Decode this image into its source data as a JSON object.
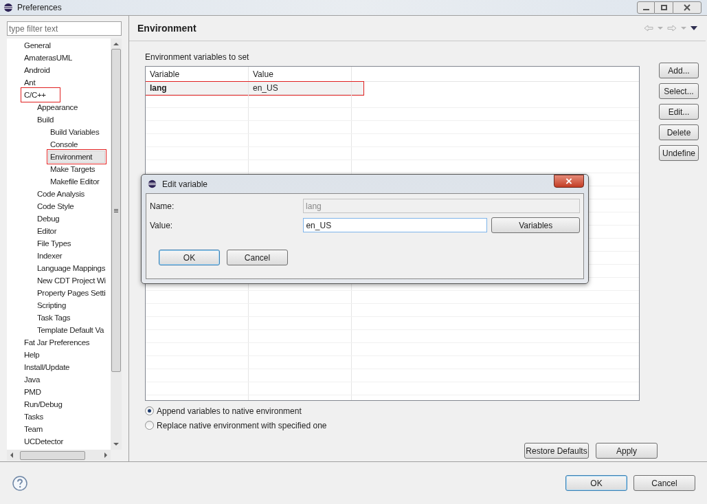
{
  "window": {
    "title": "Preferences"
  },
  "filter": {
    "placeholder": "type filter text"
  },
  "tree": [
    {
      "label": "General",
      "selected": false,
      "highlighted": false
    },
    {
      "label": "AmaterasUML",
      "selected": false,
      "highlighted": false
    },
    {
      "label": "Android",
      "selected": false,
      "highlighted": false
    },
    {
      "label": "Ant",
      "selected": false,
      "highlighted": false
    },
    {
      "label": "C/C++",
      "selected": false,
      "highlighted": true,
      "children": [
        {
          "label": "Appearance",
          "selected": false,
          "highlighted": false
        },
        {
          "label": "Build",
          "selected": false,
          "highlighted": false,
          "children": [
            {
              "label": "Build Variables",
              "selected": false,
              "highlighted": false
            },
            {
              "label": "Console",
              "selected": false,
              "highlighted": false
            },
            {
              "label": "Environment",
              "selected": true,
              "highlighted": true
            },
            {
              "label": "Make Targets",
              "selected": false,
              "highlighted": false
            },
            {
              "label": "Makefile Editor",
              "selected": false,
              "highlighted": false
            }
          ]
        },
        {
          "label": "Code Analysis",
          "selected": false,
          "highlighted": false
        },
        {
          "label": "Code Style",
          "selected": false,
          "highlighted": false
        },
        {
          "label": "Debug",
          "selected": false,
          "highlighted": false
        },
        {
          "label": "Editor",
          "selected": false,
          "highlighted": false
        },
        {
          "label": "File Types",
          "selected": false,
          "highlighted": false
        },
        {
          "label": "Indexer",
          "selected": false,
          "highlighted": false
        },
        {
          "label": "Language Mappings",
          "selected": false,
          "highlighted": false
        },
        {
          "label": "New CDT Project Wi",
          "selected": false,
          "highlighted": false
        },
        {
          "label": "Property Pages Setti",
          "selected": false,
          "highlighted": false
        },
        {
          "label": "Scripting",
          "selected": false,
          "highlighted": false
        },
        {
          "label": "Task Tags",
          "selected": false,
          "highlighted": false
        },
        {
          "label": "Template Default Va",
          "selected": false,
          "highlighted": false
        }
      ]
    },
    {
      "label": "Fat Jar Preferences",
      "selected": false,
      "highlighted": false
    },
    {
      "label": "Help",
      "selected": false,
      "highlighted": false
    },
    {
      "label": "Install/Update",
      "selected": false,
      "highlighted": false
    },
    {
      "label": "Java",
      "selected": false,
      "highlighted": false
    },
    {
      "label": "PMD",
      "selected": false,
      "highlighted": false
    },
    {
      "label": "Run/Debug",
      "selected": false,
      "highlighted": false
    },
    {
      "label": "Tasks",
      "selected": false,
      "highlighted": false
    },
    {
      "label": "Team",
      "selected": false,
      "highlighted": false
    },
    {
      "label": "UCDetector",
      "selected": false,
      "highlighted": false
    }
  ],
  "page": {
    "title": "Environment",
    "table_label": "Environment variables to set",
    "columns": [
      "Variable",
      "Value"
    ],
    "rows": [
      {
        "cells": [
          "lang",
          "en_US"
        ],
        "highlighted": true
      }
    ],
    "side_buttons": [
      "Add...",
      "Select...",
      "Edit...",
      "Delete",
      "Undefine"
    ],
    "options": [
      {
        "label": "Append variables to native environment",
        "selected": true
      },
      {
        "label": "Replace native environment with specified one",
        "selected": false
      }
    ],
    "buttons": [
      "Restore Defaults",
      "Apply"
    ]
  },
  "dialog": {
    "title": "Edit variable",
    "fields": [
      {
        "label": "Name:",
        "value": "lang",
        "disabled": true
      },
      {
        "label": "Value:",
        "value": "en_US",
        "disabled": false
      }
    ],
    "side_button": "Variables",
    "buttons": [
      {
        "label": "OK",
        "default": true
      },
      {
        "label": "Cancel",
        "default": false
      }
    ]
  },
  "footer_buttons": [
    {
      "label": "OK",
      "default": true
    },
    {
      "label": "Cancel",
      "default": false
    }
  ]
}
